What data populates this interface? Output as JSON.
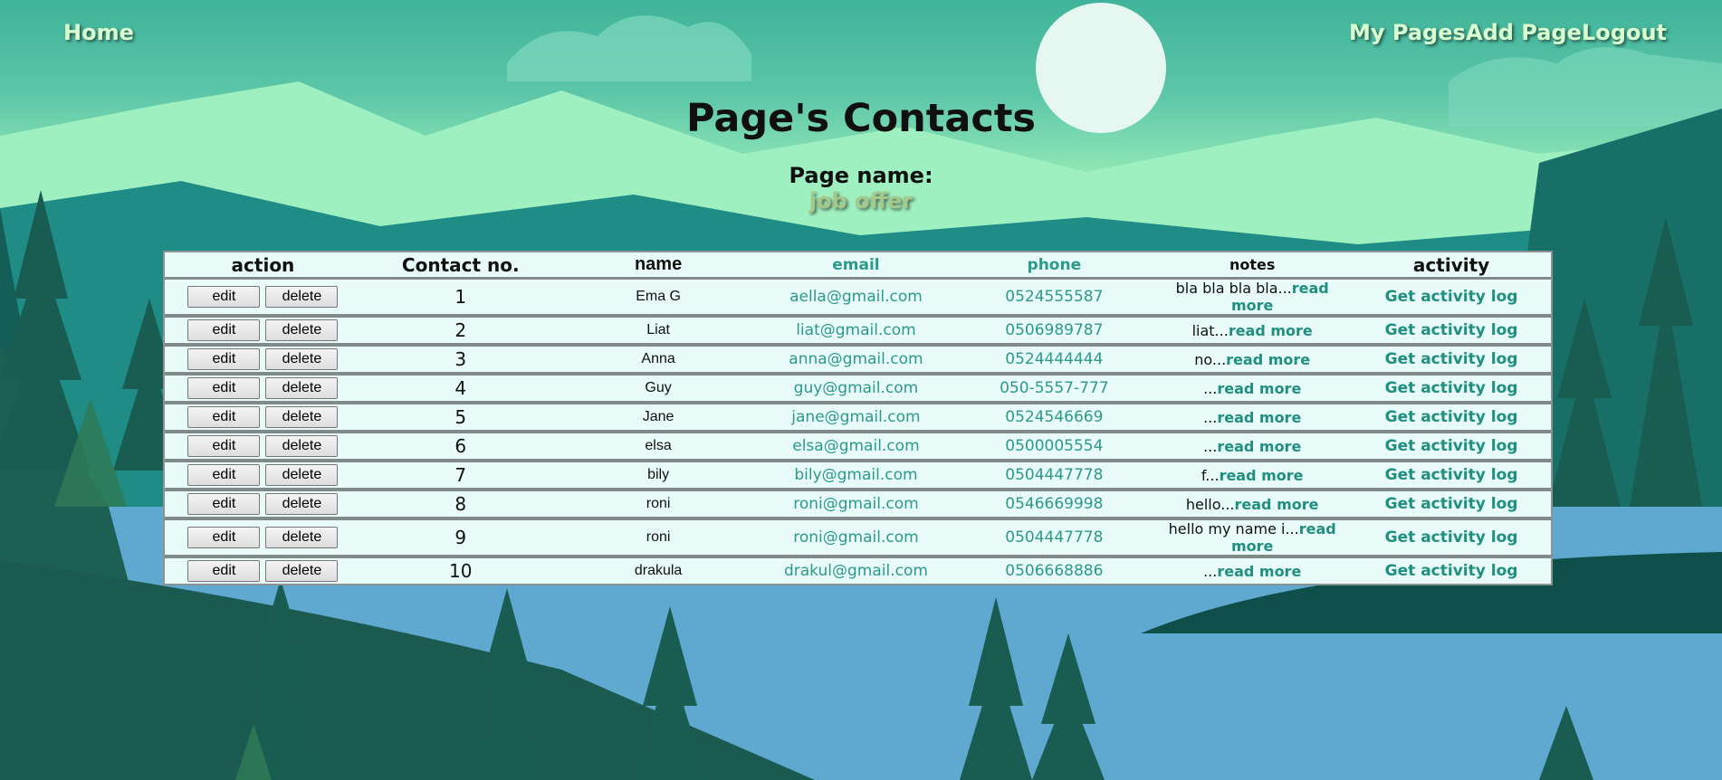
{
  "nav": {
    "home": "Home",
    "my_pages": "My Pages",
    "add_page": "Add Page",
    "logout": "Logout"
  },
  "page": {
    "title": "Page's Contacts",
    "page_name_label": "Page name:",
    "page_name": "job offer"
  },
  "table": {
    "headers": [
      "action",
      "Contact no.",
      "name",
      "email",
      "phone",
      "notes",
      "activity"
    ],
    "edit_label": "edit",
    "delete_label": "delete",
    "read_more_label": "read more",
    "activity_label": "Get activity log",
    "rows": [
      {
        "no": "1",
        "name": "Ema G",
        "email": "aella@gmail.com",
        "phone": "0524555587",
        "notes": "bla bla bla bla..."
      },
      {
        "no": "2",
        "name": "Liat",
        "email": "liat@gmail.com",
        "phone": "0506989787",
        "notes": "liat..."
      },
      {
        "no": "3",
        "name": "Anna",
        "email": "anna@gmail.com",
        "phone": "0524444444",
        "notes": "no..."
      },
      {
        "no": "4",
        "name": "Guy",
        "email": "guy@gmail.com",
        "phone": "050-5557-777",
        "notes": "..."
      },
      {
        "no": "5",
        "name": "Jane",
        "email": "jane@gmail.com",
        "phone": "0524546669",
        "notes": "..."
      },
      {
        "no": "6",
        "name": "elsa",
        "email": "elsa@gmail.com",
        "phone": "0500005554",
        "notes": "..."
      },
      {
        "no": "7",
        "name": "bily",
        "email": "bily@gmail.com",
        "phone": "0504447778",
        "notes": "f..."
      },
      {
        "no": "8",
        "name": "roni",
        "email": "roni@gmail.com",
        "phone": "0546669998",
        "notes": "hello..."
      },
      {
        "no": "9",
        "name": "roni",
        "email": "roni@gmail.com",
        "phone": "0504447778",
        "notes": "hello my name i..."
      },
      {
        "no": "10",
        "name": "drakula",
        "email": "drakul@gmail.com",
        "phone": "0506668886",
        "notes": "..."
      }
    ]
  }
}
